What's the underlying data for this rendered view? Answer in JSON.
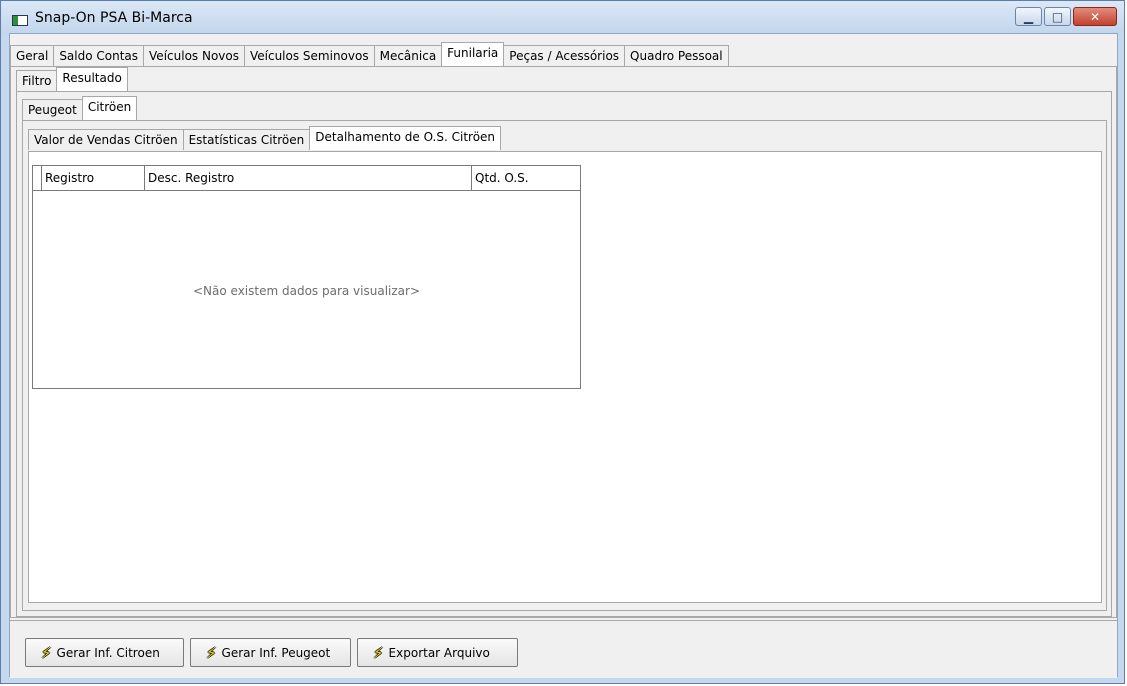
{
  "window": {
    "title": "Snap-On PSA Bi-Marca"
  },
  "tabs_main": [
    {
      "label": "Geral"
    },
    {
      "label": "Saldo Contas"
    },
    {
      "label": "Veículos Novos"
    },
    {
      "label": "Veículos Seminovos"
    },
    {
      "label": "Mecânica"
    },
    {
      "label": "Funilaria"
    },
    {
      "label": "Peças / Acessórios"
    },
    {
      "label": "Quadro Pessoal"
    }
  ],
  "tabs_level2": [
    {
      "label": "Filtro"
    },
    {
      "label": "Resultado"
    }
  ],
  "tabs_level3": [
    {
      "label": "Peugeot"
    },
    {
      "label": "Citröen"
    }
  ],
  "tabs_level4": [
    {
      "label": "Valor de Vendas Citröen"
    },
    {
      "label": "Estatísticas Citröen"
    },
    {
      "label": "Detalhamento de O.S. Citröen"
    }
  ],
  "grid": {
    "columns": [
      "Registro",
      "Desc. Registro",
      "Qtd. O.S."
    ],
    "empty_message": "<Não existem dados para visualizar>"
  },
  "footer": {
    "buttons": [
      {
        "label": "Gerar Inf. Citroen",
        "icon": "lightning-icon"
      },
      {
        "label": "Gerar Inf. Peugeot",
        "icon": "lightning-icon"
      },
      {
        "label": "Exportar Arquivo",
        "icon": "lightning-icon"
      }
    ]
  }
}
